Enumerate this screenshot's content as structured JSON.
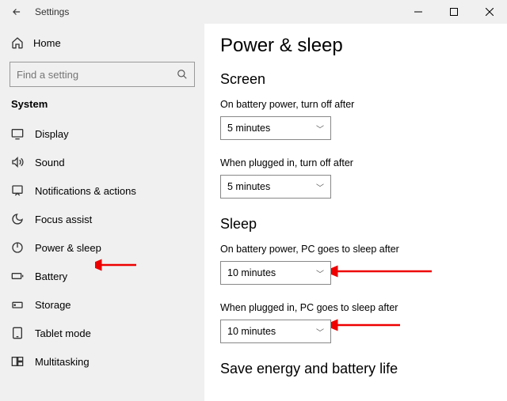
{
  "window": {
    "title": "Settings"
  },
  "home": {
    "label": "Home"
  },
  "search": {
    "placeholder": "Find a setting"
  },
  "category": "System",
  "nav": [
    {
      "label": "Display"
    },
    {
      "label": "Sound"
    },
    {
      "label": "Notifications & actions"
    },
    {
      "label": "Focus assist"
    },
    {
      "label": "Power & sleep"
    },
    {
      "label": "Battery"
    },
    {
      "label": "Storage"
    },
    {
      "label": "Tablet mode"
    },
    {
      "label": "Multitasking"
    }
  ],
  "page": {
    "title": "Power & sleep",
    "screen": {
      "heading": "Screen",
      "battery_label": "On battery power, turn off after",
      "battery_value": "5 minutes",
      "plugged_label": "When plugged in, turn off after",
      "plugged_value": "5 minutes"
    },
    "sleep": {
      "heading": "Sleep",
      "battery_label": "On battery power, PC goes to sleep after",
      "battery_value": "10 minutes",
      "plugged_label": "When plugged in, PC goes to sleep after",
      "plugged_value": "10 minutes"
    },
    "footer_heading": "Save energy and battery life"
  }
}
